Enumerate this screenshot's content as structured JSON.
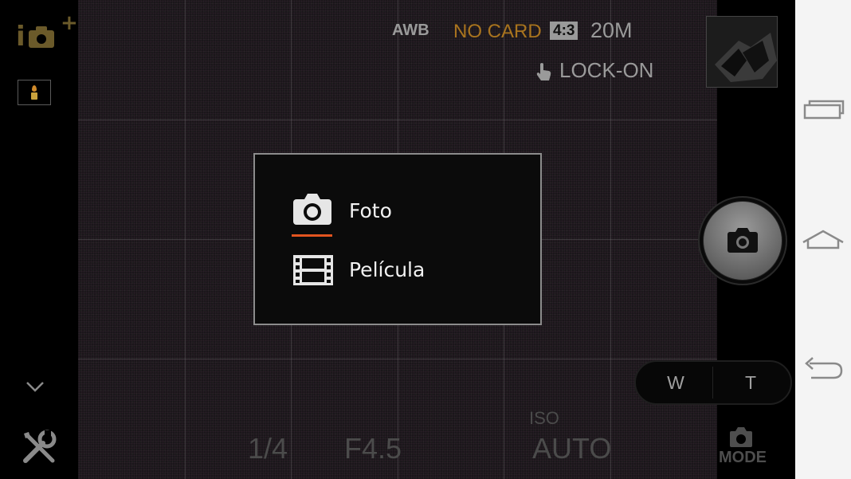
{
  "status": {
    "white_balance": "AWB",
    "card_status": "NO CARD",
    "aspect_ratio": "4:3",
    "resolution": "20M",
    "touch_mode": "LOCK-ON"
  },
  "mode_dialog": {
    "options": [
      {
        "label": "Foto",
        "icon": "camera-icon",
        "selected": true
      },
      {
        "label": "Película",
        "icon": "film-icon",
        "selected": false
      }
    ]
  },
  "exposure": {
    "shutter": "1/4",
    "aperture": "F4.5",
    "iso_label": "ISO",
    "iso_value": "AUTO"
  },
  "zoom": {
    "wide": "W",
    "tele": "T"
  },
  "mode_button": {
    "label": "MODE"
  },
  "colors": {
    "accent": "#e2541f",
    "card_warning": "#a9741e"
  }
}
